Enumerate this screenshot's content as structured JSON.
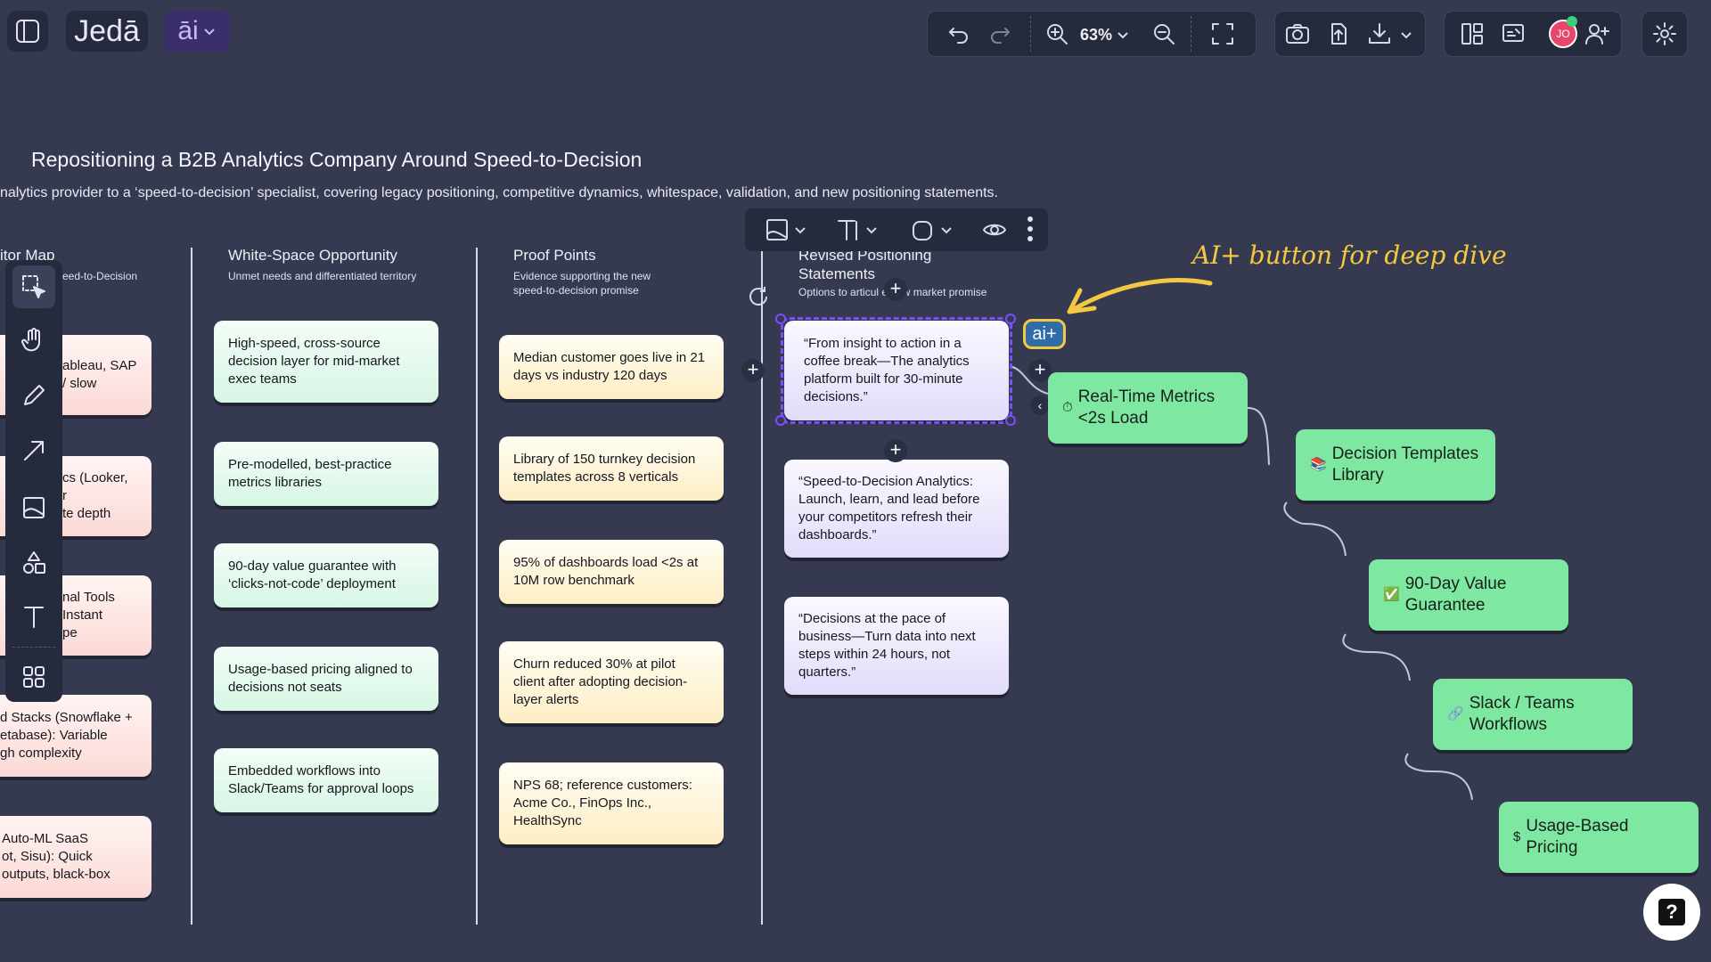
{
  "toolbar": {
    "brand": "Jedā",
    "ai_label": "āi",
    "zoom": "63%",
    "avatar_initials": "JO"
  },
  "canvas": {
    "title": "Repositioning a B2B Analytics Company Around Speed-to-Decision",
    "subtitle": "nalytics provider to a ‘speed-to-decision’ specialist, covering legacy positioning, competitive dynamics, whitespace, validation, and new positioning statements.",
    "columns": [
      {
        "title": "itor Map",
        "subtitle": "eed-to-Decision"
      },
      {
        "title": "White-Space Opportunity",
        "subtitle": "Unmet needs and differentiated territory"
      },
      {
        "title": "Proof Points",
        "subtitle": "Evidence supporting the new speed-to-decision promise"
      },
      {
        "title": "Revised Positioning Statements",
        "subtitle": "Options to articul    e new market promise"
      }
    ],
    "competitor_cards": [
      [
        "ableau, SAP",
        "/ slow"
      ],
      [
        "cs (Looker,",
        "r",
        "te depth"
      ],
      [
        "nal Tools",
        "Instant",
        "pe"
      ],
      [
        "d Stacks (Snowflake +",
        "etabase): Variable",
        "gh complexity"
      ],
      [
        "Auto-ML SaaS",
        "ot, Sisu): Quick",
        "outputs, black-box"
      ]
    ],
    "whitespace_cards": [
      "High-speed, cross-source decision layer for mid-market exec teams",
      "Pre-modelled, best-practice metrics libraries",
      "90-day value guarantee with ‘clicks-not-code’ deployment",
      "Usage-based pricing aligned to decisions not seats",
      "Embedded workflows into Slack/Teams for approval loops"
    ],
    "proof_cards": [
      "Median customer goes live in 21 days vs industry 120 days",
      "Library of 150 turnkey decision templates across 8 verticals",
      "95% of dashboards load <2s at 10M row benchmark",
      "Churn reduced 30% at pilot client after adopting decision-layer alerts",
      "NPS 68; reference customers: Acme Co., FinOps Inc., HealthSync"
    ],
    "positioning_cards": [
      "“From insight to action in a coffee break—The analytics platform built for 30-minute decisions.”",
      "“Speed-to-Decision Analytics: Launch, learn, and lead before your competitors refresh their dashboards.”",
      "“Decisions at the pace of business—Turn data into next steps within 24 hours, not quarters.”"
    ],
    "flow_nodes": [
      {
        "emoji": "⏱",
        "text": "Real-Time Metrics <2s Load"
      },
      {
        "emoji": "📚",
        "text": "Decision Templates Library"
      },
      {
        "emoji": "✅",
        "text": "90-Day Value Guarantee"
      },
      {
        "emoji": "🔗",
        "text": "Slack / Teams Workflows"
      },
      {
        "emoji": "$",
        "text": "Usage-Based Pricing"
      }
    ],
    "ai_plus_label": "ai+",
    "annotation": "AI+ button for deep dive",
    "help_label": "?"
  },
  "colors": {
    "background": "#353a50",
    "toolbar": "#252a3c",
    "flow_node": "#7ee8a2",
    "annotation": "#f5c842",
    "selection": "#7c4dff"
  }
}
